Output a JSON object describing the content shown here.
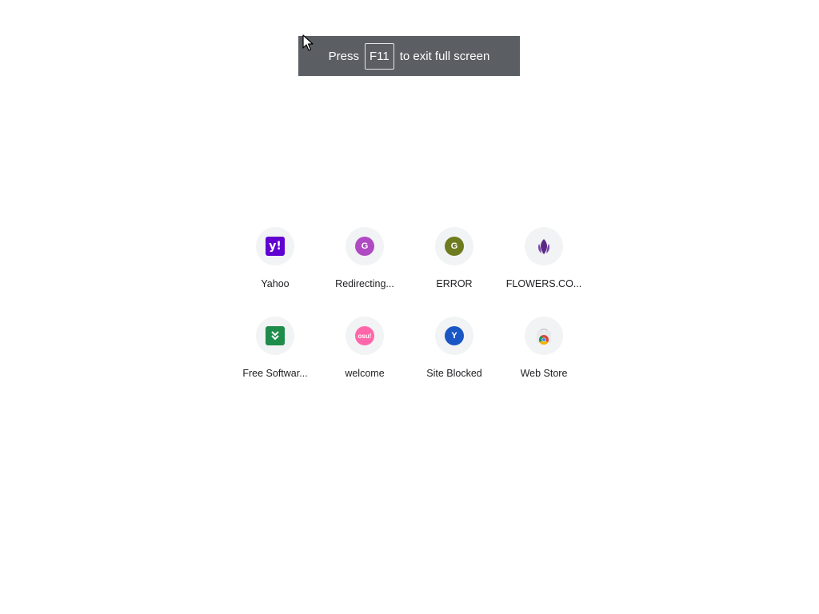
{
  "fullscreen_notice": {
    "prefix": "Press",
    "key": "F11",
    "suffix": "to exit full screen"
  },
  "shortcuts": [
    {
      "label": "Yahoo",
      "icon": "yahoo-logo-icon",
      "icon_text": "y!",
      "color": "#6001d2"
    },
    {
      "label": "Redirecting...",
      "icon": "letter-g-icon",
      "icon_text": "G",
      "color": "#b04ac2"
    },
    {
      "label": "ERROR",
      "icon": "letter-g-icon",
      "icon_text": "G",
      "color": "#6f7b1f"
    },
    {
      "label": "FLOWERS.CO...",
      "icon": "flower-logo-icon",
      "color": "#5b2a86"
    },
    {
      "label": "Free Softwar...",
      "icon": "download-logo-icon",
      "color": "#1e8c4a"
    },
    {
      "label": "welcome",
      "icon": "osu-logo-icon",
      "icon_text": "osu!",
      "color": "#ff66aa"
    },
    {
      "label": "Site Blocked",
      "icon": "letter-y-icon",
      "icon_text": "Y",
      "color": "#1a56c4"
    },
    {
      "label": "Web Store",
      "icon": "chrome-web-store-icon",
      "color": "#4285f4"
    }
  ]
}
